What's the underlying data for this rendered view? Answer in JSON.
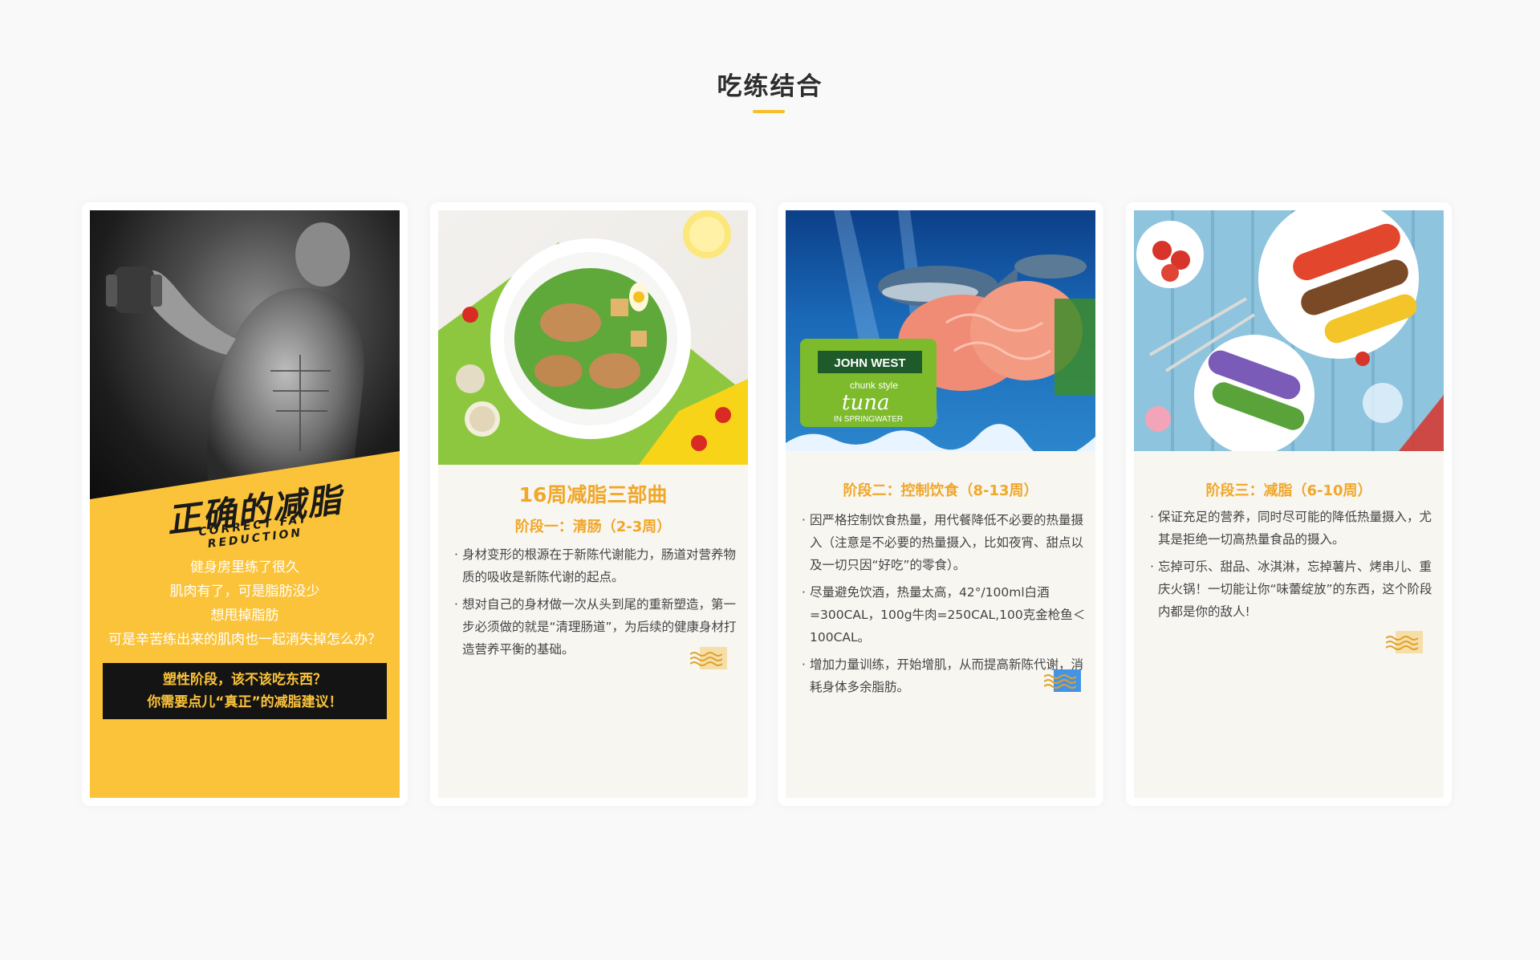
{
  "section": {
    "title": "吃练结合",
    "accent_color": "#f7c02a"
  },
  "cards": [
    {
      "image_alt": "muscular man lifting dumbbell",
      "headline": "正确的减脂",
      "headline_en": "CORRECT FAT REDUCTION",
      "lines": [
        "健身房里练了很久",
        "肌肉有了，可是脂肪没少",
        "想甩掉脂肪",
        "可是辛苦练出来的肌肉也一起消失掉怎么办？"
      ],
      "cta_line1": "塑性阶段，该不该吃东西？",
      "cta_line2": "你需要点儿“真正”的减脂建议！",
      "bg_color": "#fbc33a"
    },
    {
      "image_alt": "caesar salad",
      "title": "16周减脂三部曲",
      "subtitle": "阶段一：清肠（2-3周）",
      "bullets": [
        "身材变形的根源在于新陈代谢能力，肠道对营养物质的吸收是新陈代谢的起点。",
        "想对自己的身材做一次从头到尾的重新塑造，第一步必须做的就是“清理肠道”，为后续的健康身材打造营养平衡的基础。"
      ],
      "deco_color": "#f5dca0"
    },
    {
      "image_alt": "tuna",
      "brand_text": "JOHN WEST",
      "product_text": "chunk style",
      "product_name": "tuna",
      "product_sub": "IN SPRINGWATER",
      "subtitle": "阶段二：控制饮食（8-13周）",
      "bullets": [
        "因严格控制饮食热量，用代餐降低不必要的热量摄入（注意是不必要的热量摄入，比如夜宵、甜点以及一切只因“好吃”的零食）。",
        "尽量避免饮酒，热量太高，42°/100ml白酒=300CAL，100g牛肉=250CAL,100克金枪鱼＜100CAL。",
        "增加力量训练，开始增肌，从而提高新陈代谢，消耗身体多余脂肪。"
      ],
      "deco_color": "#2f8ae6"
    },
    {
      "image_alt": "eclairs and strawberries",
      "subtitle": "阶段三：减脂（6-10周）",
      "bullets": [
        "保证充足的营养，同时尽可能的降低热量摄入，尤其是拒绝一切高热量食品的摄入。",
        "忘掉可乐、甜品、冰淇淋，忘掉薯片、烤串儿、重庆火锅！一切能让你“味蕾绽放”的东西，这个阶段内都是你的敌人!"
      ],
      "deco_color": "#f5dca0"
    }
  ]
}
